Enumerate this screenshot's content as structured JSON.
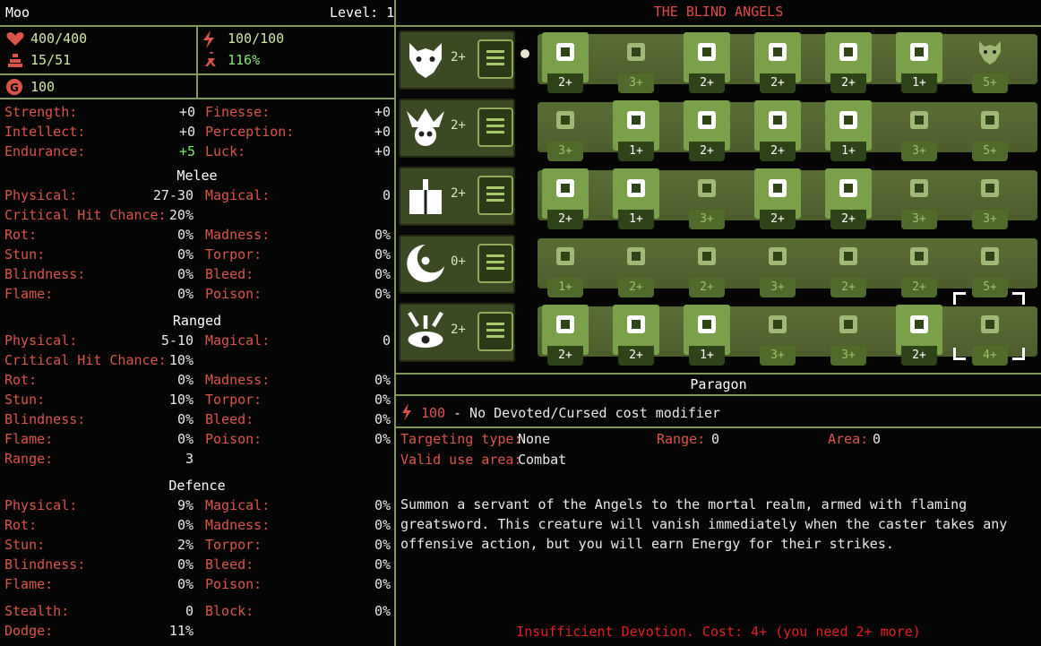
{
  "character": {
    "name": "Moo",
    "level_label": "Level: 1",
    "hp": "400/400",
    "weight": "15/51",
    "energy": "100/100",
    "speed": "116%",
    "gold": "100"
  },
  "attributes": [
    {
      "label": "Strength:",
      "value": "+0"
    },
    {
      "label": "Finesse:",
      "value": "+0"
    },
    {
      "label": "Intellect:",
      "value": "+0"
    },
    {
      "label": "Perception:",
      "value": "+0"
    },
    {
      "label": "Endurance:",
      "value": "+5"
    },
    {
      "label": "Luck:",
      "value": "+0"
    }
  ],
  "melee": {
    "title": "Melee",
    "physical": {
      "label": "Physical:",
      "value": "27-30"
    },
    "magical": {
      "label": "Magical:",
      "value": "0"
    },
    "crit": {
      "label": "Critical Hit Chance:",
      "value": "20%"
    },
    "rows": [
      {
        "l1": "Rot:",
        "v1": "0%",
        "l2": "Madness:",
        "v2": "0%"
      },
      {
        "l1": "Stun:",
        "v1": "0%",
        "l2": "Torpor:",
        "v2": "0%"
      },
      {
        "l1": "Blindness:",
        "v1": "0%",
        "l2": "Bleed:",
        "v2": "0%"
      },
      {
        "l1": "Flame:",
        "v1": "0%",
        "l2": "Poison:",
        "v2": "0%"
      }
    ]
  },
  "ranged": {
    "title": "Ranged",
    "physical": {
      "label": "Physical:",
      "value": "5-10"
    },
    "magical": {
      "label": "Magical:",
      "value": "0"
    },
    "crit": {
      "label": "Critical Hit Chance:",
      "value": "10%"
    },
    "rows": [
      {
        "l1": "Rot:",
        "v1": "0%",
        "l2": "Madness:",
        "v2": "0%"
      },
      {
        "l1": "Stun:",
        "v1": "10%",
        "l2": "Torpor:",
        "v2": "0%"
      },
      {
        "l1": "Blindness:",
        "v1": "0%",
        "l2": "Bleed:",
        "v2": "0%"
      },
      {
        "l1": "Flame:",
        "v1": "0%",
        "l2": "Poison:",
        "v2": "0%"
      }
    ],
    "range": {
      "label": "Range:",
      "value": "3"
    }
  },
  "defence": {
    "title": "Defence",
    "rows": [
      {
        "l1": "Physical:",
        "v1": "9%",
        "l2": "Magical:",
        "v2": "0%"
      },
      {
        "l1": "Rot:",
        "v1": "0%",
        "l2": "Madness:",
        "v2": "0%"
      },
      {
        "l1": "Stun:",
        "v1": "2%",
        "l2": "Torpor:",
        "v2": "0%"
      },
      {
        "l1": "Blindness:",
        "v1": "0%",
        "l2": "Bleed:",
        "v2": "0%"
      },
      {
        "l1": "Flame:",
        "v1": "0%",
        "l2": "Poison:",
        "v2": "0%"
      }
    ],
    "stealth": {
      "label": "Stealth:",
      "value": "0"
    },
    "block": {
      "label": "Block:",
      "value": "0%"
    },
    "dodge": {
      "label": "Dodge:",
      "value": "11%"
    }
  },
  "tree": {
    "title": "THE BLIND ANGELS",
    "rows": [
      {
        "god": "wolf-head-icon",
        "god_cost": "2+",
        "skills": [
          {
            "icon": "hand-strike-icon",
            "cost": "2+",
            "learnable": true
          },
          {
            "icon": "dash-figure-icon",
            "cost": "3+",
            "learnable": false
          },
          {
            "icon": "blade-star-icon",
            "cost": "2+",
            "learnable": true
          },
          {
            "icon": "spiral-icon",
            "cost": "2+",
            "learnable": true
          },
          {
            "icon": "fist-burst-icon",
            "cost": "2+",
            "learnable": true
          },
          {
            "icon": "figure-arms-up-icon",
            "cost": "1+",
            "learnable": true
          },
          {
            "icon": "wolf-head-icon",
            "cost": "5+",
            "learnable": false
          }
        ]
      },
      {
        "god": "jester-skull-icon",
        "god_cost": "2+",
        "skills": [
          {
            "icon": "arrow-cross-icon",
            "cost": "3+",
            "learnable": false
          },
          {
            "icon": "card-plus-icon",
            "cost": "1+",
            "learnable": true
          },
          {
            "icon": "two-figures-icon",
            "cost": "2+",
            "learnable": true
          },
          {
            "icon": "figure-door-icon",
            "cost": "2+",
            "learnable": true
          },
          {
            "icon": "running-figure-icon",
            "cost": "1+",
            "learnable": true
          },
          {
            "icon": "dice-icon",
            "cost": "3+",
            "learnable": false
          },
          {
            "icon": "scythe-icon",
            "cost": "5+",
            "learnable": false
          }
        ]
      },
      {
        "god": "candle-book-icon",
        "god_cost": "2+",
        "skills": [
          {
            "icon": "spikes-icon",
            "cost": "2+",
            "learnable": true
          },
          {
            "icon": "eye-exclaim-icon",
            "cost": "1+",
            "learnable": true
          },
          {
            "icon": "barrel-icon",
            "cost": "3+",
            "learnable": false
          },
          {
            "icon": "crystal-icon",
            "cost": "2+",
            "learnable": true
          },
          {
            "icon": "idol-icon",
            "cost": "2+",
            "learnable": true
          },
          {
            "icon": "ladder-icon",
            "cost": "3+",
            "learnable": false
          },
          {
            "icon": "bone-icon",
            "cost": "3+",
            "learnable": false
          }
        ]
      },
      {
        "god": "crescent-moon-icon",
        "god_cost": "0+",
        "skills": [
          {
            "icon": "key-drop-icon",
            "cost": "1+",
            "learnable": false
          },
          {
            "icon": "fangs-icon",
            "cost": "2+",
            "learnable": false
          },
          {
            "icon": "arrows-icon",
            "cost": "2+",
            "learnable": false
          },
          {
            "icon": "chaos-star-icon",
            "cost": "3+",
            "learnable": false
          },
          {
            "icon": "machine-icon",
            "cost": "2+",
            "learnable": false
          },
          {
            "icon": "broken-heart-icon",
            "cost": "2+",
            "learnable": false
          },
          {
            "icon": "sun-eclipse-icon",
            "cost": "5+",
            "learnable": false
          }
        ]
      },
      {
        "god": "antler-eye-icon",
        "god_cost": "2+",
        "skills": [
          {
            "icon": "claw-scroll-icon",
            "cost": "2+",
            "learnable": true
          },
          {
            "icon": "mummy-figures-icon",
            "cost": "2+",
            "learnable": true
          },
          {
            "icon": "heart-eye-icon",
            "cost": "1+",
            "learnable": true
          },
          {
            "icon": "checker-mountain-icon",
            "cost": "3+",
            "learnable": false
          },
          {
            "icon": "snowflake-icon",
            "cost": "3+",
            "learnable": false
          },
          {
            "icon": "cross-plus-icon",
            "cost": "2+",
            "learnable": true
          },
          {
            "icon": "winged-angel-icon",
            "cost": "4+",
            "learnable": false
          }
        ]
      }
    ]
  },
  "skill_detail": {
    "name": "Paragon",
    "energy_cost": "100",
    "cost_note": "- No Devoted/Cursed cost modifier",
    "targeting_label": "Targeting type:",
    "targeting_value": "None",
    "range_label": "Range:",
    "range_value": "0",
    "area_label": "Area:",
    "area_value": "0",
    "valid_label": "Valid use area:",
    "valid_value": "Combat",
    "description": "Summon a servant of the Angels to the mortal realm, armed with flaming greatsword. This creature will vanish immediately when the caster takes any offensive action, but you will earn Energy for their strikes.",
    "warning": "Insufficient Devotion. Cost: 4+ (you need 2+ more)"
  },
  "colors": {
    "label_red": "#d9554a",
    "accent_green": "#7fe870",
    "frame_green": "#7f9a55",
    "title_red": "#e04a4a"
  }
}
